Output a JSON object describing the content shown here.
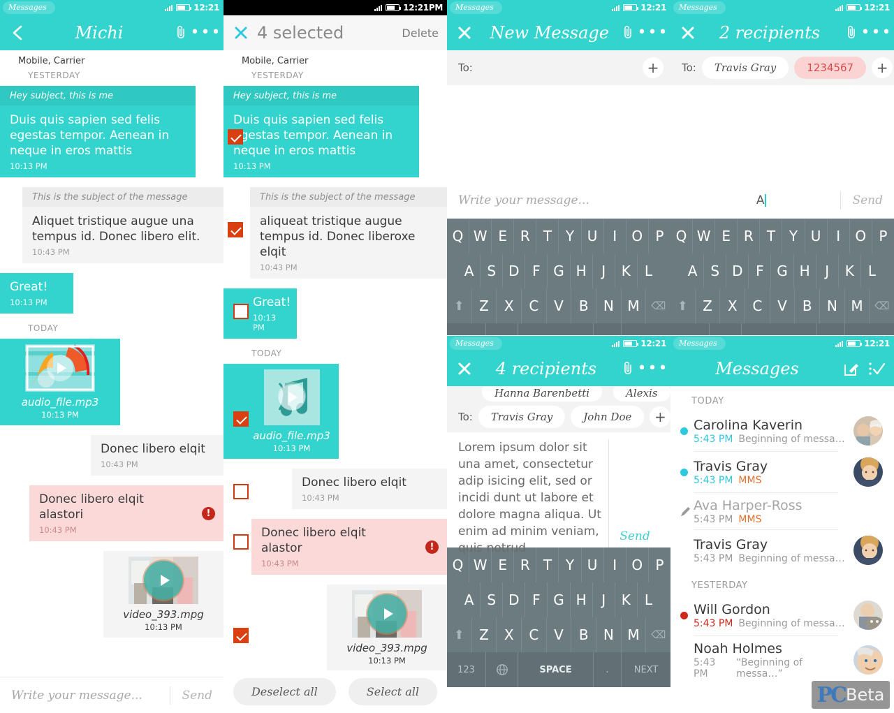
{
  "status_bar": {
    "app_label": "Messages",
    "time": "12:21",
    "time_alt": "12:21PM"
  },
  "panel1": {
    "header": {
      "title": "Michi",
      "back_icon": "chevron-left-icon",
      "attach_icon": "paperclip-icon",
      "more_icon": "more-icon"
    },
    "carrier": "Mobile, Carrier",
    "day_yesterday": "YESTERDAY",
    "day_today": "TODAY",
    "messages": [
      {
        "subject": "Hey subject, this is me",
        "body": "Duis quis sapien sed felis egestas tempor. Aenean in neque in eros mattis",
        "time": "10:13 PM"
      },
      {
        "subject": "This is the subject of the message",
        "body": "Aliquet tristique augue una tempus id. Donec libero elit.",
        "time": "10:43 PM"
      },
      {
        "body": "Great!",
        "time": "10:13 PM"
      },
      {
        "media": "audio_file.mp3",
        "time": "10:13 PM"
      },
      {
        "body": "Donec libero elqit",
        "time": "10:43 PM"
      },
      {
        "body": "Donec libero elqit alastori",
        "time": "10:43 PM"
      },
      {
        "media": "video_393.mpg",
        "time": "10:13 PM"
      }
    ],
    "composer": {
      "placeholder": "Write your message...",
      "send_label": "Send"
    }
  },
  "panel2": {
    "header": {
      "title": "4 selected",
      "close_icon": "close-icon",
      "delete_label": "Delete"
    },
    "carrier": "Mobile, Carrier",
    "day_yesterday": "YESTERDAY",
    "day_today": "TODAY",
    "messages": [
      {
        "subject": "Hey subject, this is me",
        "body": "Duis quis sapien sed felis egestas tempor. Aenean in neque in eros mattis",
        "time": "10:13 PM",
        "checked": true
      },
      {
        "subject": "This is the subject of the message",
        "body": "aliqueat tristique augue tempus id. Donec liberoxe elqit",
        "time": "10:43 PM",
        "checked": true
      },
      {
        "body": "Great!",
        "time": "10:13 PM",
        "checked": false
      },
      {
        "media": "audio_file.mp3",
        "time": "10:13 PM",
        "checked": true
      },
      {
        "body": "Donec libero elqit",
        "time": "10:43 PM",
        "checked": false
      },
      {
        "body": "Donec libero elqit alastor",
        "time": "10:43 PM",
        "checked": false
      },
      {
        "media": "video_393.mpg",
        "time": "10:13 PM",
        "checked": true
      }
    ],
    "footer": {
      "deselect_all": "Deselect all",
      "select_all": "Select all"
    }
  },
  "panel3": {
    "header": {
      "title": "New Message",
      "close_icon": "close-icon",
      "attach_icon": "paperclip-icon",
      "more_icon": "more-icon"
    },
    "to_label": "To:",
    "add_icon": "plus-icon",
    "composer": {
      "placeholder": "Write your message...",
      "send_label": "Send"
    },
    "keyboard": {
      "row1": [
        "Q",
        "W",
        "E",
        "R",
        "T",
        "Y",
        "U",
        "I",
        "O",
        "P"
      ],
      "row2": [
        "A",
        "S",
        "D",
        "F",
        "G",
        "H",
        "J",
        "K",
        "L"
      ],
      "row3": [
        "Z",
        "X",
        "C",
        "V",
        "B",
        "N",
        "M"
      ],
      "num_key": "123",
      "space_key": "SPACE",
      "period_key": ".",
      "next_key": "NEXT",
      "shift_icon": "shift-icon",
      "backspace_icon": "backspace-icon",
      "globe_icon": "globe-icon"
    }
  },
  "panel4": {
    "header": {
      "title": "2 recipients",
      "close_icon": "close-icon",
      "attach_icon": "paperclip-icon",
      "more_icon": "more-icon"
    },
    "to_label": "To:",
    "chips": [
      {
        "label": "Travis Gray",
        "invalid": false
      },
      {
        "label": "1234567",
        "invalid": true
      }
    ],
    "add_icon": "plus-icon",
    "composer": {
      "typed_text": "A",
      "send_label": "Send"
    }
  },
  "panel5": {
    "header": {
      "title": "4 recipients",
      "close_icon": "close-icon",
      "attach_icon": "paperclip-icon",
      "more_icon": "more-icon"
    },
    "to_label": "To:",
    "chips_hidden_row": [
      "Hanna Barenbetti",
      "Alexis"
    ],
    "chips": [
      "Travis Gray",
      "John Doe"
    ],
    "add_icon": "plus-icon",
    "body_text": "Lorem ipsum dolor sit una amet, consectetur adip isicing elit, sed or incidi dunt ut labore et dolore magna aliqua. Ut enim ad minim veniam, quis notrud",
    "send_label": "Send"
  },
  "panel6": {
    "header": {
      "title": "Messages",
      "compose_icon": "compose-icon",
      "menu_check_icon": "menu-check-icon"
    },
    "groups": [
      {
        "day": "TODAY",
        "items": [
          {
            "name": "Carolina Kaverin",
            "time": "5:43 PM",
            "preview": "Beginning of messa…",
            "dot": "blue",
            "time_color": "blue",
            "avatar": "avatar-couple"
          },
          {
            "name": "Travis Gray",
            "time": "5:43 PM",
            "preview": "MMS",
            "dot": "blue",
            "time_color": "blue",
            "preview_kind": "mms",
            "avatar": "avatar-curly"
          },
          {
            "name": "Ava Harper-Ross",
            "time": "5:43 PM",
            "preview": "MMS",
            "dot": "draft",
            "time_color": "grey",
            "preview_kind": "mms",
            "muted": true,
            "avatar": "avatar-none"
          },
          {
            "name": "Travis Gray",
            "time": "5:43 PM",
            "preview": "Beginning of messa…",
            "dot": "none",
            "time_color": "grey",
            "avatar": "avatar-curly"
          }
        ]
      },
      {
        "day": "YESTERDAY",
        "items": [
          {
            "name": "Will Gordon",
            "time": "5:43 PM",
            "preview": "Beginning of messa…",
            "dot": "red",
            "time_color": "red",
            "avatar": "avatar-cat"
          },
          {
            "name": "Noah Holmes",
            "time": "5:43 PM",
            "preview": "“Beginning of messa…”",
            "dot": "none",
            "time_color": "grey",
            "avatar": "avatar-smile"
          }
        ]
      }
    ]
  },
  "watermark": {
    "pc": "PC",
    "beta": "Beta"
  },
  "colors": {
    "teal": "#33d4cd",
    "checkbox_red": "#d93f11",
    "error_red": "#c3261b",
    "error_bg": "#fbd9d9",
    "keyboard": "#6c7b80",
    "link_blue": "#2fc6dd",
    "mms_orange": "#e2702f"
  }
}
